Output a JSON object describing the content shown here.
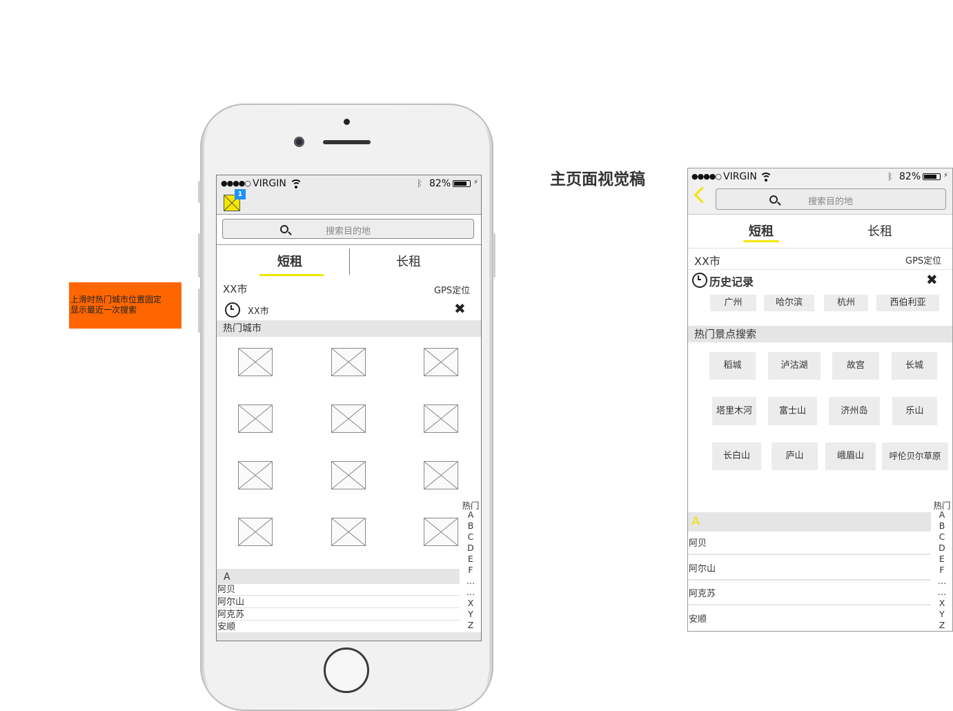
{
  "annotation": {
    "text": "上滑时热门城市位置固定\n显示最近一次搜索",
    "line1": "上滑时热门城市位置固定",
    "line2": "显示最近一次搜索",
    "color": "#ff6600"
  },
  "page_title": "主页面视觉稿",
  "status_bar": {
    "signal_dots": "●●●●○",
    "carrier": "VIRGIN",
    "battery": "82%",
    "bluetooth_icon": "bluetooth-icon",
    "wifi_icon": "wifi-icon"
  },
  "colors": {
    "accent": "#f2e500",
    "badge": "#1e90ff"
  },
  "screen1": {
    "badge_count": "1",
    "search_placeholder": "搜索目的地",
    "tabs": [
      {
        "label": "短租",
        "active": true
      },
      {
        "label": "长租",
        "active": false
      }
    ],
    "city": "XX市",
    "gps": "GPS定位",
    "recent_search": "XX市",
    "hot_section": "热门城市",
    "hot_grid_rows": 4,
    "hot_grid_cols": 3,
    "index": [
      "热门",
      "A",
      "B",
      "C",
      "D",
      "E",
      "F",
      "…",
      "…",
      "X",
      "Y",
      "Z"
    ],
    "alpha_head": "A",
    "cities": [
      "阿贝",
      "阿尔山",
      "阿克苏",
      "安顺"
    ]
  },
  "screen2": {
    "search_placeholder": "搜索目的地",
    "tabs": [
      {
        "label": "短租",
        "active": true
      },
      {
        "label": "长租",
        "active": false
      }
    ],
    "city": "XX市",
    "gps": "GPS定位",
    "history_title": "历史记录",
    "history": [
      "广州",
      "哈尔滨",
      "杭州",
      "西伯利亚"
    ],
    "hot_section": "热门景点搜索",
    "spots": [
      [
        "稻城",
        "泸沽湖",
        "故宫",
        "长城"
      ],
      [
        "塔里木河",
        "富士山",
        "济州岛",
        "乐山"
      ],
      [
        "长白山",
        "庐山",
        "峨眉山",
        "呼伦贝尔草原"
      ]
    ],
    "index": [
      "热门",
      "A",
      "B",
      "C",
      "D",
      "E",
      "F",
      "…",
      "…",
      "X",
      "Y",
      "Z"
    ],
    "alpha_head": "A",
    "cities": [
      "阿贝",
      "阿尔山",
      "阿克苏",
      "安顺"
    ]
  }
}
